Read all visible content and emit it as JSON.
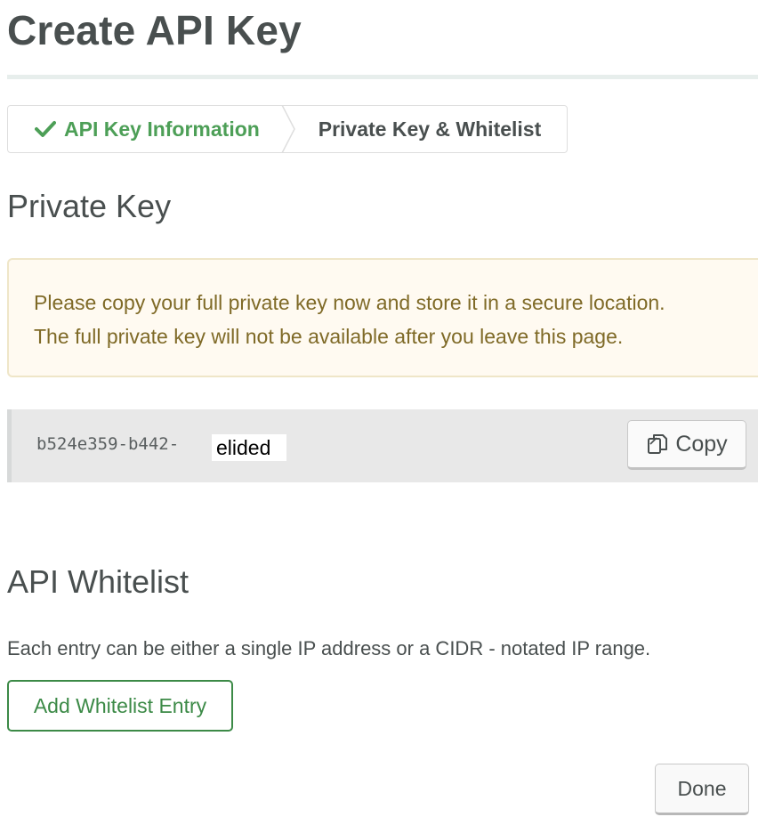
{
  "page": {
    "title": "Create API Key"
  },
  "stepper": {
    "steps": [
      {
        "label": "API Key Information",
        "state": "completed",
        "icon": "check-icon"
      },
      {
        "label": "Private Key & Whitelist",
        "state": "current"
      }
    ]
  },
  "private_key": {
    "heading": "Private Key",
    "warning_line_1": "Please copy your full private key now and store it in a secure location.",
    "warning_line_2": "The full private key will not be available after you leave this page.",
    "key_value": "b524e359-b442-",
    "redaction_label": "elided",
    "copy_label": "Copy",
    "copy_icon": "copy-icon"
  },
  "whitelist": {
    "heading": "API Whitelist",
    "description": "Each entry can be either a single IP address or a CIDR - notated IP range.",
    "add_label": "Add Whitelist Entry"
  },
  "footer": {
    "done_label": "Done"
  },
  "colors": {
    "success_green": "#4d9f57",
    "button_green": "#3c8a47",
    "warning_text": "#7f6a27",
    "warning_bg": "#fffaf1"
  }
}
